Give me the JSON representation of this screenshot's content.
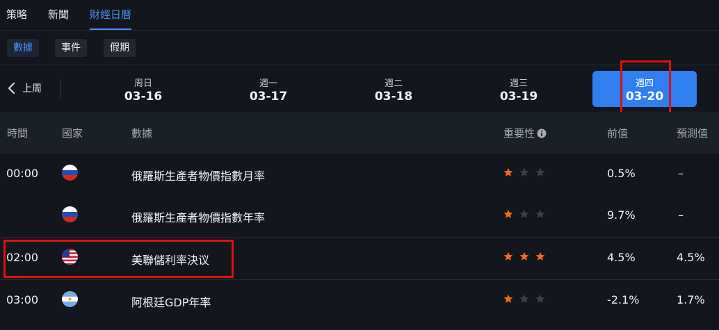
{
  "top_tabs": [
    {
      "label": "策略",
      "active": false
    },
    {
      "label": "新聞",
      "active": false
    },
    {
      "label": "財經日曆",
      "active": true
    }
  ],
  "sub_tabs": [
    {
      "label": "數據",
      "active": true
    },
    {
      "label": "事件",
      "active": false
    },
    {
      "label": "假期",
      "active": false
    }
  ],
  "prev_week_label": "上周",
  "days": [
    {
      "name": "周日",
      "date": "03-16",
      "active": false
    },
    {
      "name": "週一",
      "date": "03-17",
      "active": false
    },
    {
      "name": "週二",
      "date": "03-18",
      "active": false
    },
    {
      "name": "週三",
      "date": "03-19",
      "active": false
    },
    {
      "name": "週四",
      "date": "03-20",
      "active": true
    }
  ],
  "columns": {
    "time": "時間",
    "country": "國家",
    "data": "數據",
    "importance": "重要性",
    "previous": "前值",
    "forecast": "預測值"
  },
  "rows": [
    {
      "time": "00:00",
      "country_flag": "russia-flag-icon",
      "name": "俄羅斯生產者物價指數月率",
      "importance": 1,
      "previous": "0.5%",
      "forecast": "–"
    },
    {
      "time": "",
      "country_flag": "russia-flag-icon",
      "name": "俄羅斯生產者物價指數年率",
      "importance": 1,
      "previous": "9.7%",
      "forecast": "–"
    },
    {
      "time": "02:00",
      "country_flag": "usa-flag-icon",
      "name": "美聯儲利率決议",
      "importance": 3,
      "previous": "4.5%",
      "forecast": "4.5%"
    },
    {
      "time": "03:00",
      "country_flag": "argentina-flag-icon",
      "name": "阿根廷GDP年率",
      "importance": 1,
      "previous": "-2.1%",
      "forecast": "1.7%"
    }
  ],
  "colors": {
    "accent": "#2f7ff0",
    "star_on": "#f26b1d",
    "star_off": "#3a3f4a",
    "highlight_box": "#e01010"
  }
}
